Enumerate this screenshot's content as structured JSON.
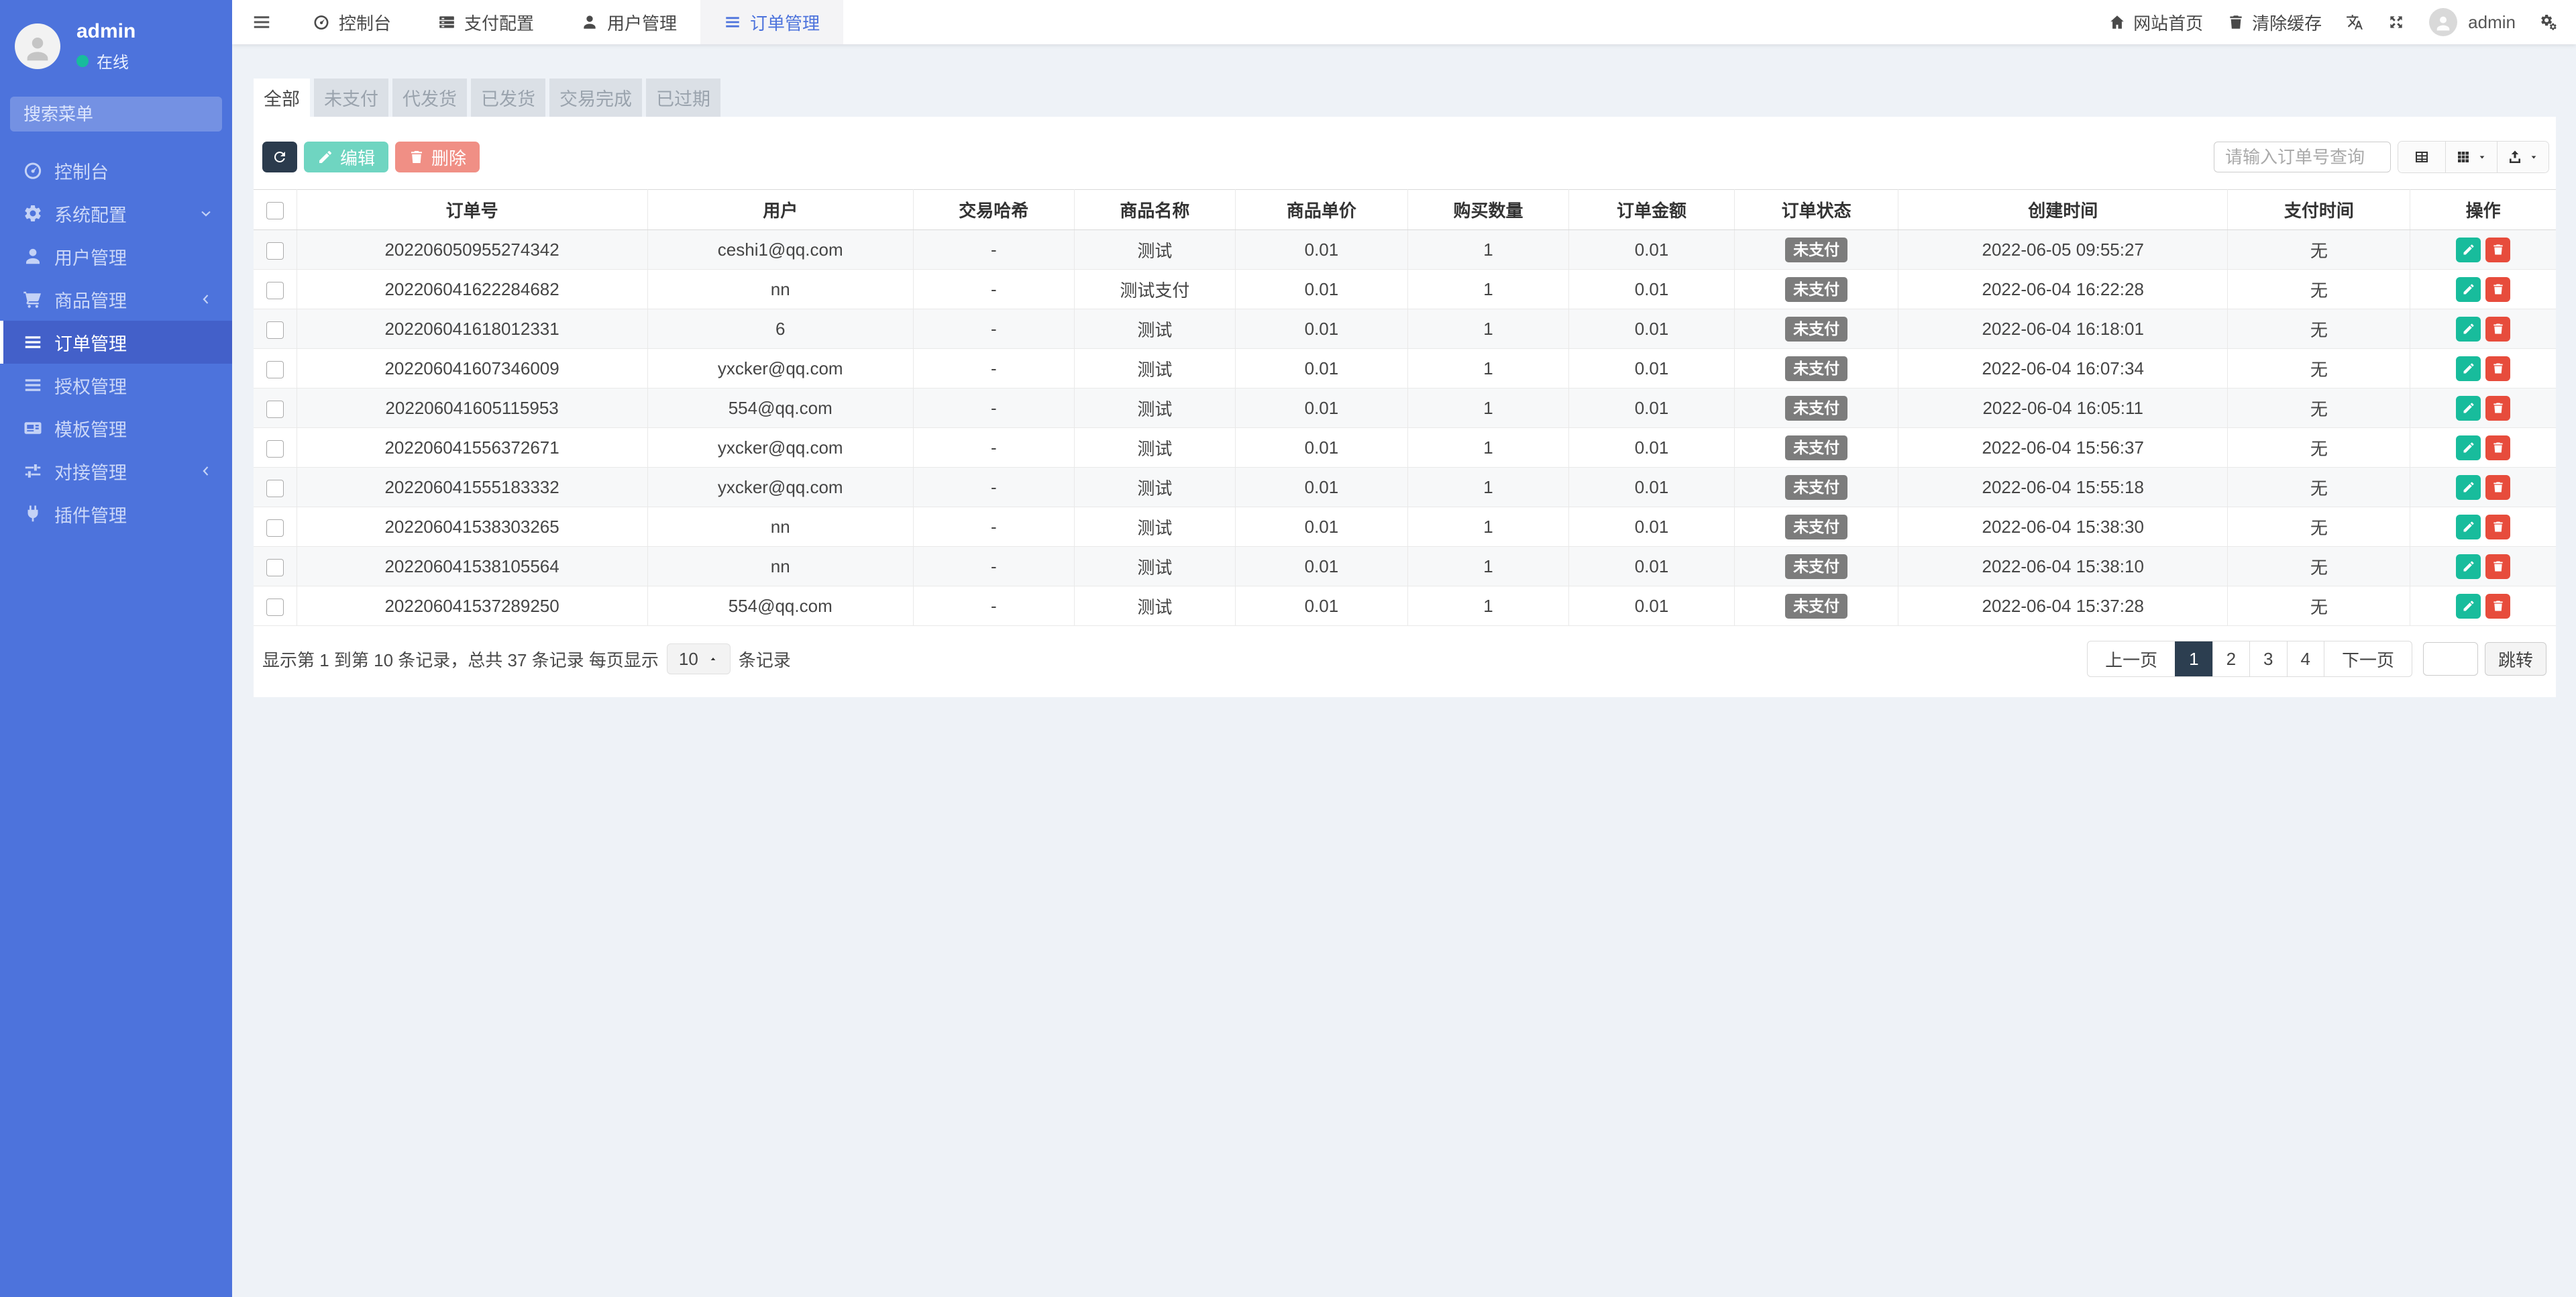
{
  "colors": {
    "sidebar_bg": "#4d73dc",
    "sidebar_active_bg": "#4360c9",
    "accent_blue": "#4d73dc",
    "dark_navy": "#2c3e50",
    "success_green": "#18bc9c",
    "danger_red": "#e74c3c",
    "badge_gray": "#7c7c7c",
    "online_green": "#18bc9c",
    "content_bg": "#eef2f7"
  },
  "sidebar": {
    "user": {
      "name": "admin",
      "status": "在线"
    },
    "search_placeholder": "搜索菜单",
    "items": [
      {
        "label": "控制台",
        "icon": "gauge-icon"
      },
      {
        "label": "系统配置",
        "icon": "gear-icon",
        "chevron": "down"
      },
      {
        "label": "用户管理",
        "icon": "user-icon"
      },
      {
        "label": "商品管理",
        "icon": "cart-icon",
        "chevron": "left"
      },
      {
        "label": "订单管理",
        "icon": "list-icon",
        "active": true
      },
      {
        "label": "授权管理",
        "icon": "list-icon"
      },
      {
        "label": "模板管理",
        "icon": "template-icon"
      },
      {
        "label": "对接管理",
        "icon": "sliders-icon",
        "chevron": "left"
      },
      {
        "label": "插件管理",
        "icon": "plug-icon"
      }
    ]
  },
  "topbar": {
    "menu": [
      {
        "label": "控制台",
        "icon": "gauge-icon"
      },
      {
        "label": "支付配置",
        "icon": "server-icon"
      },
      {
        "label": "用户管理",
        "icon": "user-icon"
      },
      {
        "label": "订单管理",
        "icon": "list-icon",
        "active": true
      }
    ],
    "right": {
      "home_label": "网站首页",
      "clear_cache_label": "清除缓存",
      "username": "admin"
    }
  },
  "filter_tabs": [
    {
      "label": "全部",
      "active": true
    },
    {
      "label": "未支付"
    },
    {
      "label": "代发货"
    },
    {
      "label": "已发货"
    },
    {
      "label": "交易完成"
    },
    {
      "label": "已过期"
    }
  ],
  "toolbar": {
    "edit_label": "编辑",
    "delete_label": "删除",
    "search_placeholder": "请输入订单号查询"
  },
  "table": {
    "columns": [
      "订单号",
      "用户",
      "交易哈希",
      "商品名称",
      "商品单价",
      "购买数量",
      "订单金额",
      "订单状态",
      "创建时间",
      "支付时间",
      "操作"
    ],
    "rows": [
      {
        "order_no": "202206050955274342",
        "user": "ceshi1@qq.com",
        "hash": "-",
        "product": "测试",
        "price": "0.01",
        "qty": "1",
        "amount": "0.01",
        "status": "未支付",
        "created": "2022-06-05 09:55:27",
        "paid": "无"
      },
      {
        "order_no": "202206041622284682",
        "user": "nn",
        "hash": "-",
        "product": "测试支付",
        "price": "0.01",
        "qty": "1",
        "amount": "0.01",
        "status": "未支付",
        "created": "2022-06-04 16:22:28",
        "paid": "无"
      },
      {
        "order_no": "202206041618012331",
        "user": "6",
        "hash": "-",
        "product": "测试",
        "price": "0.01",
        "qty": "1",
        "amount": "0.01",
        "status": "未支付",
        "created": "2022-06-04 16:18:01",
        "paid": "无"
      },
      {
        "order_no": "202206041607346009",
        "user": "yxcker@qq.com",
        "hash": "-",
        "product": "测试",
        "price": "0.01",
        "qty": "1",
        "amount": "0.01",
        "status": "未支付",
        "created": "2022-06-04 16:07:34",
        "paid": "无"
      },
      {
        "order_no": "202206041605115953",
        "user": "554@qq.com",
        "hash": "-",
        "product": "测试",
        "price": "0.01",
        "qty": "1",
        "amount": "0.01",
        "status": "未支付",
        "created": "2022-06-04 16:05:11",
        "paid": "无"
      },
      {
        "order_no": "202206041556372671",
        "user": "yxcker@qq.com",
        "hash": "-",
        "product": "测试",
        "price": "0.01",
        "qty": "1",
        "amount": "0.01",
        "status": "未支付",
        "created": "2022-06-04 15:56:37",
        "paid": "无"
      },
      {
        "order_no": "202206041555183332",
        "user": "yxcker@qq.com",
        "hash": "-",
        "product": "测试",
        "price": "0.01",
        "qty": "1",
        "amount": "0.01",
        "status": "未支付",
        "created": "2022-06-04 15:55:18",
        "paid": "无"
      },
      {
        "order_no": "202206041538303265",
        "user": "nn",
        "hash": "-",
        "product": "测试",
        "price": "0.01",
        "qty": "1",
        "amount": "0.01",
        "status": "未支付",
        "created": "2022-06-04 15:38:30",
        "paid": "无"
      },
      {
        "order_no": "202206041538105564",
        "user": "nn",
        "hash": "-",
        "product": "测试",
        "price": "0.01",
        "qty": "1",
        "amount": "0.01",
        "status": "未支付",
        "created": "2022-06-04 15:38:10",
        "paid": "无"
      },
      {
        "order_no": "202206041537289250",
        "user": "554@qq.com",
        "hash": "-",
        "product": "测试",
        "price": "0.01",
        "qty": "1",
        "amount": "0.01",
        "status": "未支付",
        "created": "2022-06-04 15:37:28",
        "paid": "无"
      }
    ]
  },
  "footer": {
    "info_prefix": "显示第 1 到第 10 条记录，总共 37 条记录 每页显示",
    "page_size": "10",
    "info_suffix": "条记录",
    "pagination": {
      "prev": "上一页",
      "pages": [
        "1",
        "2",
        "3",
        "4"
      ],
      "active_page": "1",
      "next": "下一页",
      "jump_label": "跳转"
    }
  }
}
